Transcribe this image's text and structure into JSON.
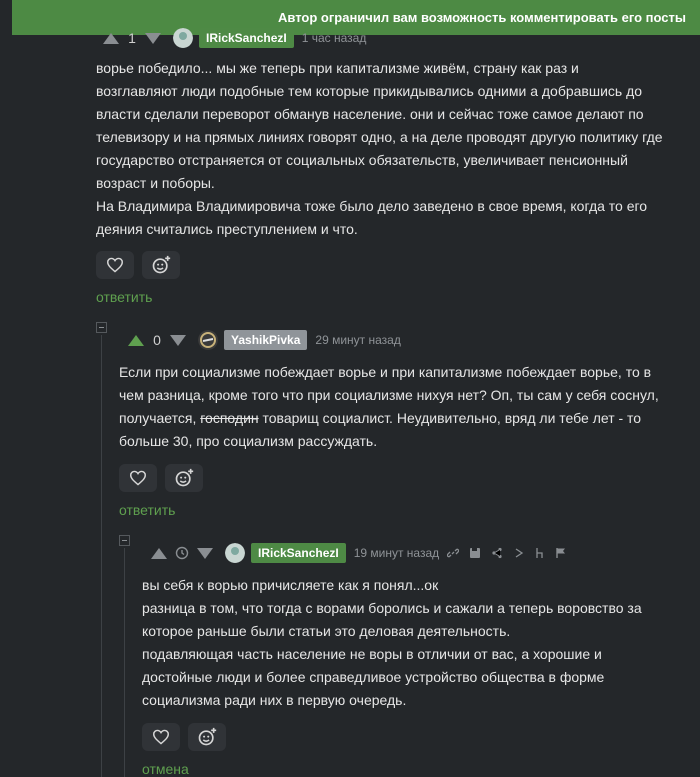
{
  "banner": {
    "text": "Автор ограничил вам возможность комментировать его посты"
  },
  "comment1": {
    "rating": "1",
    "username": "IRickSanchezI",
    "time": "1 час назад",
    "lines": [
      "ворье победило... мы же теперь при капитализме живём, страну как раз и",
      "возглавляют люди подобные тем которые прикидывались одними а добравшись до",
      "власти сделали переворот обманув население. они и сейчас тоже самое делают по",
      "телевизору и на прямых линиях говорят одно, а на деле проводят другую политику где",
      "государство отстраняется от социальных обязательств, увеличивает пенсионный",
      "возраст и поборы.",
      "На Владимира Владимировича тоже было дело заведено в свое время, когда то его",
      "деяния считались преступлением и что."
    ],
    "reply": "ответить"
  },
  "comment2": {
    "rating": "0",
    "username": "YashikPivka",
    "time": "29 минут назад",
    "line1": "Если при социализме побеждает ворье и при капитализме побеждает ворье, то в",
    "line2": "чем разница, кроме того что при социализме нихуя нет? Оп, ты сам у себя соснул,",
    "line3_pre": "получается,",
    "line3_strike": "господин",
    "line3_post": "товарищ социалист. Неудивительно, вряд ли тебе лет - то",
    "line4": "больше 30, про социализм рассуждать.",
    "reply": "ответить"
  },
  "comment3": {
    "username": "IRickSanchezI",
    "time": "19 минут назад",
    "lines": [
      "вы себя к ворью причисляете как я понял...ок",
      "разница в том, что тогда с ворами боролись и сажали а теперь воровство за",
      "которое раньше были статьи это деловая деятельность.",
      "подавляющая часть население не воры в отличии от вас, а хорошие и",
      "достойные люди и более справедливое устройство общества в форме",
      "социализма ради них в первую очередь."
    ],
    "cancel": "отмена"
  },
  "colors": {
    "accent_green": "#5fa04f",
    "banner_green": "#4d8a44",
    "user_badge_green": "#4e8a45",
    "user_badge_gray": "#8f9499"
  },
  "icons": [
    "heart-icon",
    "emoji-add-icon",
    "arrow-up-icon",
    "arrow-down-icon",
    "clock-icon",
    "link-icon",
    "save-icon",
    "share-icon",
    "hide-icon",
    "flag-icon"
  ]
}
